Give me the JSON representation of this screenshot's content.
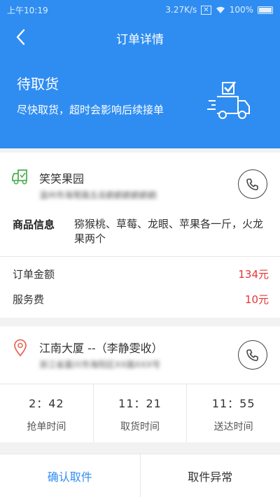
{
  "status_bar": {
    "time": "上午10:19",
    "speed": "3.27K/s",
    "battery": "100%"
  },
  "nav": {
    "title": "订单详情"
  },
  "banner": {
    "status": "待取货",
    "hint": "尽快取货，超时会影响后续接单"
  },
  "shop": {
    "name": "笑笑果园",
    "address_blurred": "温州市海鹭路五岳鹤鹤鹤鹤鹤鹤",
    "goods_label": "商品信息",
    "goods_text": "猕猴桃、草莓、龙眼、苹果各一斤，火龙果两个"
  },
  "money": {
    "amount_label": "订单金额",
    "amount_value": "134元",
    "fee_label": "服务费",
    "fee_value": "10元"
  },
  "delivery": {
    "name": "江南大厦 --（李静雯收）",
    "address_blurred": "浙江省嘉兴市海阳区XX路XXX号"
  },
  "times": [
    {
      "value": "2：42",
      "label": "抢单时间"
    },
    {
      "value": "11：21",
      "label": "取货时间"
    },
    {
      "value": "11：55",
      "label": "送达时间"
    }
  ],
  "actions": {
    "confirm": "确认取件",
    "abnormal": "取件异常"
  },
  "colors": {
    "primary": "#2f8df1",
    "price": "#e63535",
    "store_icon": "#4caf50",
    "pin_icon": "#e86a5a"
  }
}
